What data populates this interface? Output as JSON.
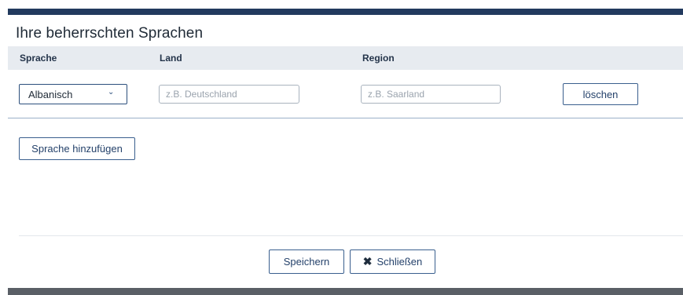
{
  "dialog": {
    "title": "Ihre beherrschten Sprachen"
  },
  "table": {
    "headers": {
      "language": "Sprache",
      "country": "Land",
      "region": "Region"
    },
    "rows": [
      {
        "language": "Albanisch",
        "country_placeholder": "z.B. Deutschland",
        "region_placeholder": "z.B. Saarland",
        "delete_label": "löschen"
      }
    ]
  },
  "actions": {
    "add_language": "Sprache hinzufügen",
    "save": "Speichern",
    "close": "Schließen"
  },
  "icons": {
    "select_chevron": "chevron-down-icon",
    "close": "close-icon"
  },
  "colors": {
    "header_bar": "#223a5e",
    "table_header_bg": "#e7ebf0",
    "button_border": "#3a5f8e",
    "footer_bar": "#5a5f66"
  }
}
